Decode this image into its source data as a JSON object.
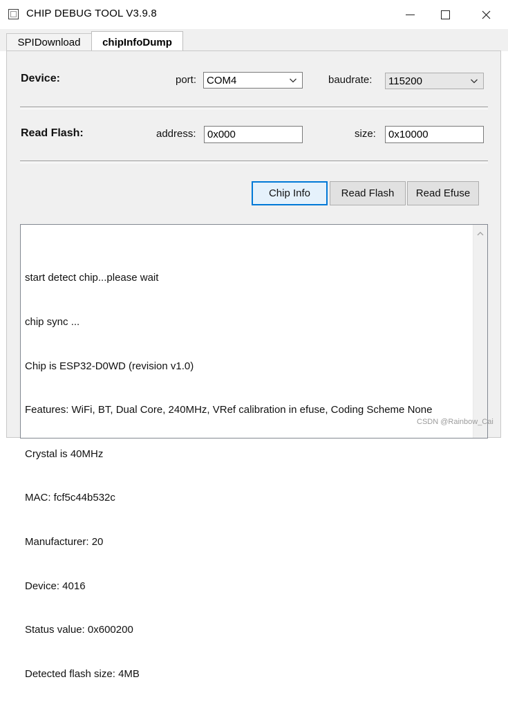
{
  "window": {
    "title": "CHIP DEBUG TOOL V3.9.8",
    "icons": {
      "app": "app-window-icon",
      "minimize": "minimize-icon",
      "maximize": "maximize-icon",
      "close": "close-icon"
    }
  },
  "tabs": [
    {
      "label": "SPIDownload",
      "active": false
    },
    {
      "label": "chipInfoDump",
      "active": true
    }
  ],
  "device": {
    "label": "Device:",
    "port_label": "port:",
    "port_value": "COM4",
    "baudrate_label": "baudrate:",
    "baudrate_value": "115200"
  },
  "read_flash": {
    "label": "Read Flash:",
    "address_label": "address:",
    "address_value": "0x000",
    "size_label": "size:",
    "size_value": "0x10000"
  },
  "buttons": {
    "chip_info": "Chip Info",
    "read_flash": "Read Flash",
    "read_efuse": "Read Efuse"
  },
  "log": {
    "lines": [
      "start detect chip...please wait",
      "chip sync ...",
      "Chip is ESP32-D0WD (revision v1.0)",
      "Features: WiFi, BT, Dual Core, 240MHz, VRef calibration in efuse, Coding Scheme None",
      "Crystal is 40MHz",
      "MAC: fcf5c44b532c",
      "Manufacturer: 20",
      "Device: 4016",
      "Status value: 0x600200",
      "Detected flash size: 4MB"
    ]
  },
  "watermark": "CSDN @Rainbow_Cai",
  "colors": {
    "accent": "#0078d7",
    "panel_bg": "#f0f0f0"
  }
}
